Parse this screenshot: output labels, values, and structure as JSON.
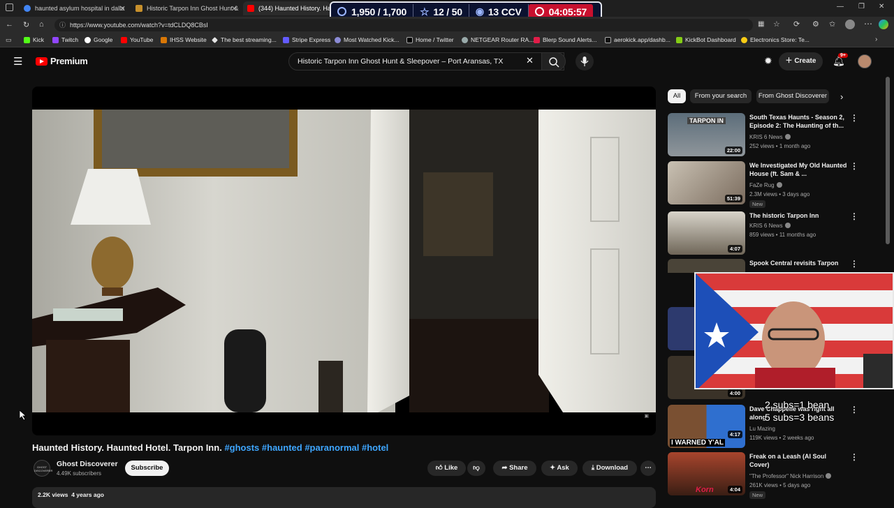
{
  "browser": {
    "tabs": [
      {
        "title": "haunted asylum hospital in dalla"
      },
      {
        "title": "Historic Tarpon Inn Ghost Hunt &"
      },
      {
        "title": "(344) Haunted History. Haunt"
      }
    ],
    "url": "https://www.youtube.com/watch?v=tdCLDQ8CBsI",
    "bookmarks": [
      "Kick",
      "Twitch",
      "Google",
      "YouTube",
      "IHSS Website",
      "The best streaming...",
      "Stripe Express",
      "Most Watched Kick...",
      "Home / Twitter",
      "NETGEAR Router RA...",
      "Blerp Sound Alerts...",
      "aerokick.app/dashb...",
      "KickBot Dashboard",
      "Electronics Store: Te..."
    ]
  },
  "stream_overlay": {
    "followers": "1,950 / 1,700",
    "stars": "12 / 50",
    "viewers": "13 CCV",
    "timer": "04:05:57"
  },
  "youtube": {
    "logo_text": "Premium",
    "search_query": "Historic Tarpon Inn Ghost Hunt & Sleepover – Port Aransas, TX",
    "create_label": "Create",
    "notif_badge": "9+"
  },
  "video": {
    "title_text": "Haunted History. Haunted Hotel. Tarpon Inn.",
    "tags": [
      "#ghosts",
      "#haunted",
      "#paranormal",
      "#hotel"
    ],
    "channel": "Ghost Discoverer",
    "channel_avatar_text": "GHOST DISCOVERER",
    "subscribers": "4.49K subscribers",
    "subscribe_label": "Subscribe",
    "like_label": "Like",
    "share_label": "Share",
    "ask_label": "Ask",
    "download_label": "Download",
    "views": "2.2K views",
    "age": "4 years ago"
  },
  "chips": [
    "All",
    "From your search",
    "From Ghost Discoverer"
  ],
  "recommendations": [
    {
      "title": "South Texas Haunts - Season 2, Episode 2: The Haunting of th...",
      "channel": "KRIS 6 News",
      "verified": true,
      "meta": "252 views • 1 month ago",
      "duration": "22:00",
      "thumb_text": "TARPON IN"
    },
    {
      "title": "We Investigated My Old Haunted House (ft. Sam & ...",
      "channel": "FaZe Rug",
      "verified": true,
      "meta": "2.3M views • 3 days ago",
      "duration": "51:39",
      "new": "New"
    },
    {
      "title": "The historic Tarpon Inn",
      "channel": "KRIS 6 News",
      "verified": true,
      "meta": "859 views • 11 months ago",
      "duration": "4:07"
    },
    {
      "title": "Spook Central revisits Tarpon",
      "channel": "",
      "meta": "",
      "duration": ""
    },
    {
      "title": "Dave Chappelle was right all along",
      "channel": "Lu Mazing",
      "verified": false,
      "meta": "119K views • 2 weeks ago",
      "duration": "4:17",
      "thumb_text": "I WARNED Y'AL"
    },
    {
      "title": "Freak on a Leash (AI Soul Cover)",
      "channel": "\"The Professor\" Nick Harrison",
      "verified": true,
      "meta": "261K views • 5 days ago",
      "duration": "4:04",
      "new": "New",
      "thumb_text": "Korn"
    }
  ],
  "hidden_durations": [
    "4:00"
  ],
  "stream_subs_text": [
    "2 subs=1 bean",
    "5 subs=3 beans"
  ],
  "colors": {
    "background": "#0f0f0f",
    "yt_red": "#ff0000",
    "hashtag_blue": "#3ea6ff",
    "overlay_bg": "#0b1230",
    "timer_red": "#c8102e"
  }
}
